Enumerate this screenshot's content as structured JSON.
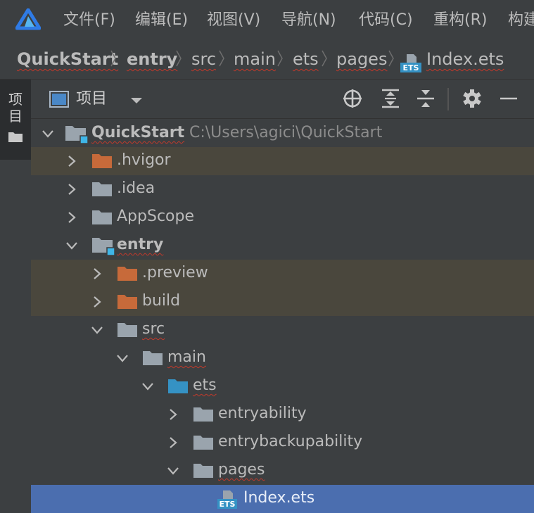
{
  "menu": [
    "文件(F)",
    "编辑(E)",
    "视图(V)",
    "导航(N)",
    "代码(C)",
    "重构(R)",
    "构建"
  ],
  "breadcrumb": [
    "QuickStart",
    "entry",
    "src",
    "main",
    "ets",
    "pages",
    "Index.ets"
  ],
  "side_tab": {
    "label": "项目",
    "icon": "folder-icon"
  },
  "project_panel": {
    "title": "项目",
    "tools": [
      "locate-icon",
      "expand-all-icon",
      "collapse-all-icon",
      "gear-icon",
      "minimize-icon"
    ]
  },
  "tree": [
    {
      "label": "QuickStart",
      "path": "C:\\Users\\agici\\QuickStart",
      "state": "expanded",
      "icon": "module-folder-icon",
      "bold": true
    },
    {
      "label": ".hvigor",
      "state": "collapsed",
      "icon": "excluded-folder-icon",
      "excluded": true
    },
    {
      "label": ".idea",
      "state": "collapsed",
      "icon": "folder-icon"
    },
    {
      "label": "AppScope",
      "state": "collapsed",
      "icon": "folder-icon"
    },
    {
      "label": "entry",
      "state": "expanded",
      "icon": "module-folder-icon",
      "bold": true
    },
    {
      "label": ".preview",
      "state": "collapsed",
      "icon": "excluded-folder-icon",
      "excluded": true
    },
    {
      "label": "build",
      "state": "collapsed",
      "icon": "excluded-folder-icon",
      "excluded": true
    },
    {
      "label": "src",
      "state": "expanded",
      "icon": "folder-icon"
    },
    {
      "label": "main",
      "state": "expanded",
      "icon": "folder-icon"
    },
    {
      "label": "ets",
      "state": "expanded",
      "icon": "source-folder-icon"
    },
    {
      "label": "entryability",
      "state": "collapsed",
      "icon": "folder-icon"
    },
    {
      "label": "entrybackupability",
      "state": "collapsed",
      "icon": "folder-icon"
    },
    {
      "label": "pages",
      "state": "expanded",
      "icon": "folder-icon"
    },
    {
      "label": "Index.ets",
      "icon": "ets-file-icon",
      "selected": true
    }
  ],
  "colors": {
    "background": "#3c3f41",
    "selection": "#4b6eaf",
    "excluded_row": "#4a473d",
    "excluded_folder": "#c76a3a",
    "source_folder": "#3592c4",
    "module_badge": "#3fb6e8"
  }
}
